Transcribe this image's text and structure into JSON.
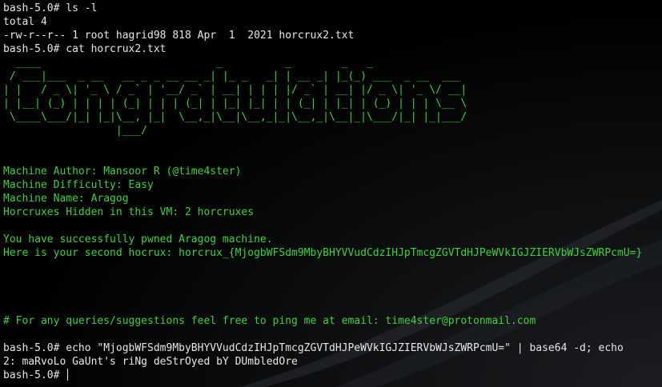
{
  "terminal": {
    "lines": [
      {
        "text": "bash-5.0# ls -l",
        "style": "plain"
      },
      {
        "text": "total 4",
        "style": "plain"
      },
      {
        "text": "-rw-r--r-- 1 root hagrid98 818 Apr  1  2021 horcrux2.txt",
        "style": "plain"
      },
      {
        "text": "bash-5.0# cat horcrux2.txt",
        "style": "plain"
      },
      {
        "text": "  ____                            _          _        _   _",
        "style": "green"
      },
      {
        "text": " / ___|___  _ __   __ _ _ __ __ _| |_ _   _| | __ _| |_(_) ___  _ __  ___",
        "style": "green"
      },
      {
        "text": "| |   / _ \\| '_ \\ / _` | '__/ _` | __| | | | |/ _` | __| |/ _ \\| '_ \\/ __|",
        "style": "green"
      },
      {
        "text": "| |__| (_) | | | | (_| | | | (_| | |_| |_| | | (_| | |_| | (_) | | | \\__ \\",
        "style": "green"
      },
      {
        "text": " \\____\\___/|_| |_|\\__, |_|  \\__,_|\\__|\\__,_|_|\\__,_|\\__|_|\\___/|_| |_|___/",
        "style": "green"
      },
      {
        "text": "                  |___/",
        "style": "green"
      },
      {
        "text": "",
        "style": "green"
      },
      {
        "text": "",
        "style": "green"
      },
      {
        "text": "Machine Author: Mansoor R (@time4ster)",
        "style": "green"
      },
      {
        "text": "Machine Difficulty: Easy",
        "style": "green"
      },
      {
        "text": "Machine Name: Aragog",
        "style": "green"
      },
      {
        "text": "Horcruxes Hidden in this VM: 2 horcruxes",
        "style": "green"
      },
      {
        "text": "",
        "style": "green"
      },
      {
        "text": "You have successfully pwned Aragog machine.",
        "style": "green"
      },
      {
        "text": "Here is your second hocrux: horcrux_{MjogbWFSdm9MbyBHYVVudCdzIHJpTmcgZGVTdHJPeWVkIGJZIERVbWJsZWRPcmU=}",
        "style": "green"
      },
      {
        "text": "",
        "style": "green"
      },
      {
        "text": "",
        "style": "green"
      },
      {
        "text": "",
        "style": "green"
      },
      {
        "text": "",
        "style": "green"
      },
      {
        "text": "# For any queries/suggestions feel free to ping me at email: time4ster@protonmail.com",
        "style": "green"
      },
      {
        "text": "",
        "style": "plain"
      },
      {
        "text": "bash-5.0# echo \"MjogbWFSdm9MbyBHYVVudCdzIHJpTmcgZGVTdHJPeWVkIGJZIERVbWJsZWRPcmU=\" | base64 -d; echo",
        "style": "plain"
      },
      {
        "text": "2: maRvoLo GaUnt's riNg deStrOyed bY DUmbledOre",
        "style": "plain"
      },
      {
        "text": "bash-5.0# ",
        "style": "plain",
        "cursor": true
      }
    ]
  }
}
